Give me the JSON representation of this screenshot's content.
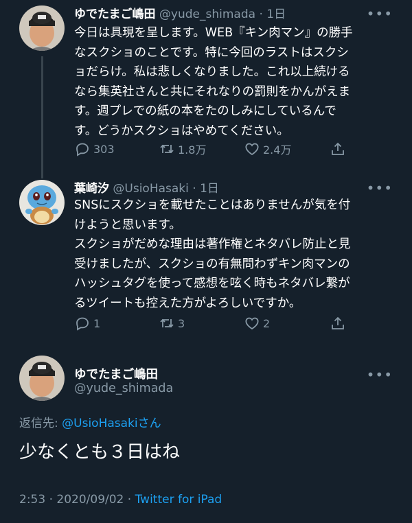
{
  "tweets": [
    {
      "name": "ゆでたまご嶋田",
      "handle": "@yude_shimada",
      "time": "· 1日",
      "text": "今日は具現を呈します。WEB『キン肉マン』の勝手\nなスクショのことです。特に今回のラストはスクシ\nョだらけ。私は悲しくなりました。これ以上続ける\nなら集英社さんと共にそれなりの罰則をかんがえま\nす。週プレでの紙の本をたのしみにしているんで\nす。どうかスクショはやめてください。",
      "replies": "303",
      "retweets": "1.8万",
      "likes": "2.4万"
    },
    {
      "name": "葉崎汐",
      "handle": "@UsioHasaki",
      "time": "· 1日",
      "text": "SNSにスクショを載せたことはありませんが気を付\nけようと思います。\nスクショがだめな理由は著作権とネタバレ防止と見\n受けましたが、スクショの有無問わずキン肉マンの\nハッシュタグを使って感想を呟く時もネタバレ繋が\nるツイートも控えた方がよろしいですか。",
      "replies": "1",
      "retweets": "3",
      "likes": "2"
    }
  ],
  "focus": {
    "name": "ゆでたまご嶋田",
    "handle": "@yude_shimada",
    "reply_prefix": "返信先: ",
    "reply_user": "@UsioHasaki",
    "reply_suffix": "さん",
    "text": "少なくとも３日はね",
    "timestamp": "2:53 · 2020/09/02 · ",
    "source": "Twitter for iPad"
  },
  "more_label": "•••",
  "icons": [
    "reply-icon",
    "retweet-icon",
    "like-icon",
    "share-icon",
    "more-icon"
  ],
  "colors": {
    "background": "#15202b",
    "secondary": "#8899a6",
    "accent": "#1da1f2"
  }
}
